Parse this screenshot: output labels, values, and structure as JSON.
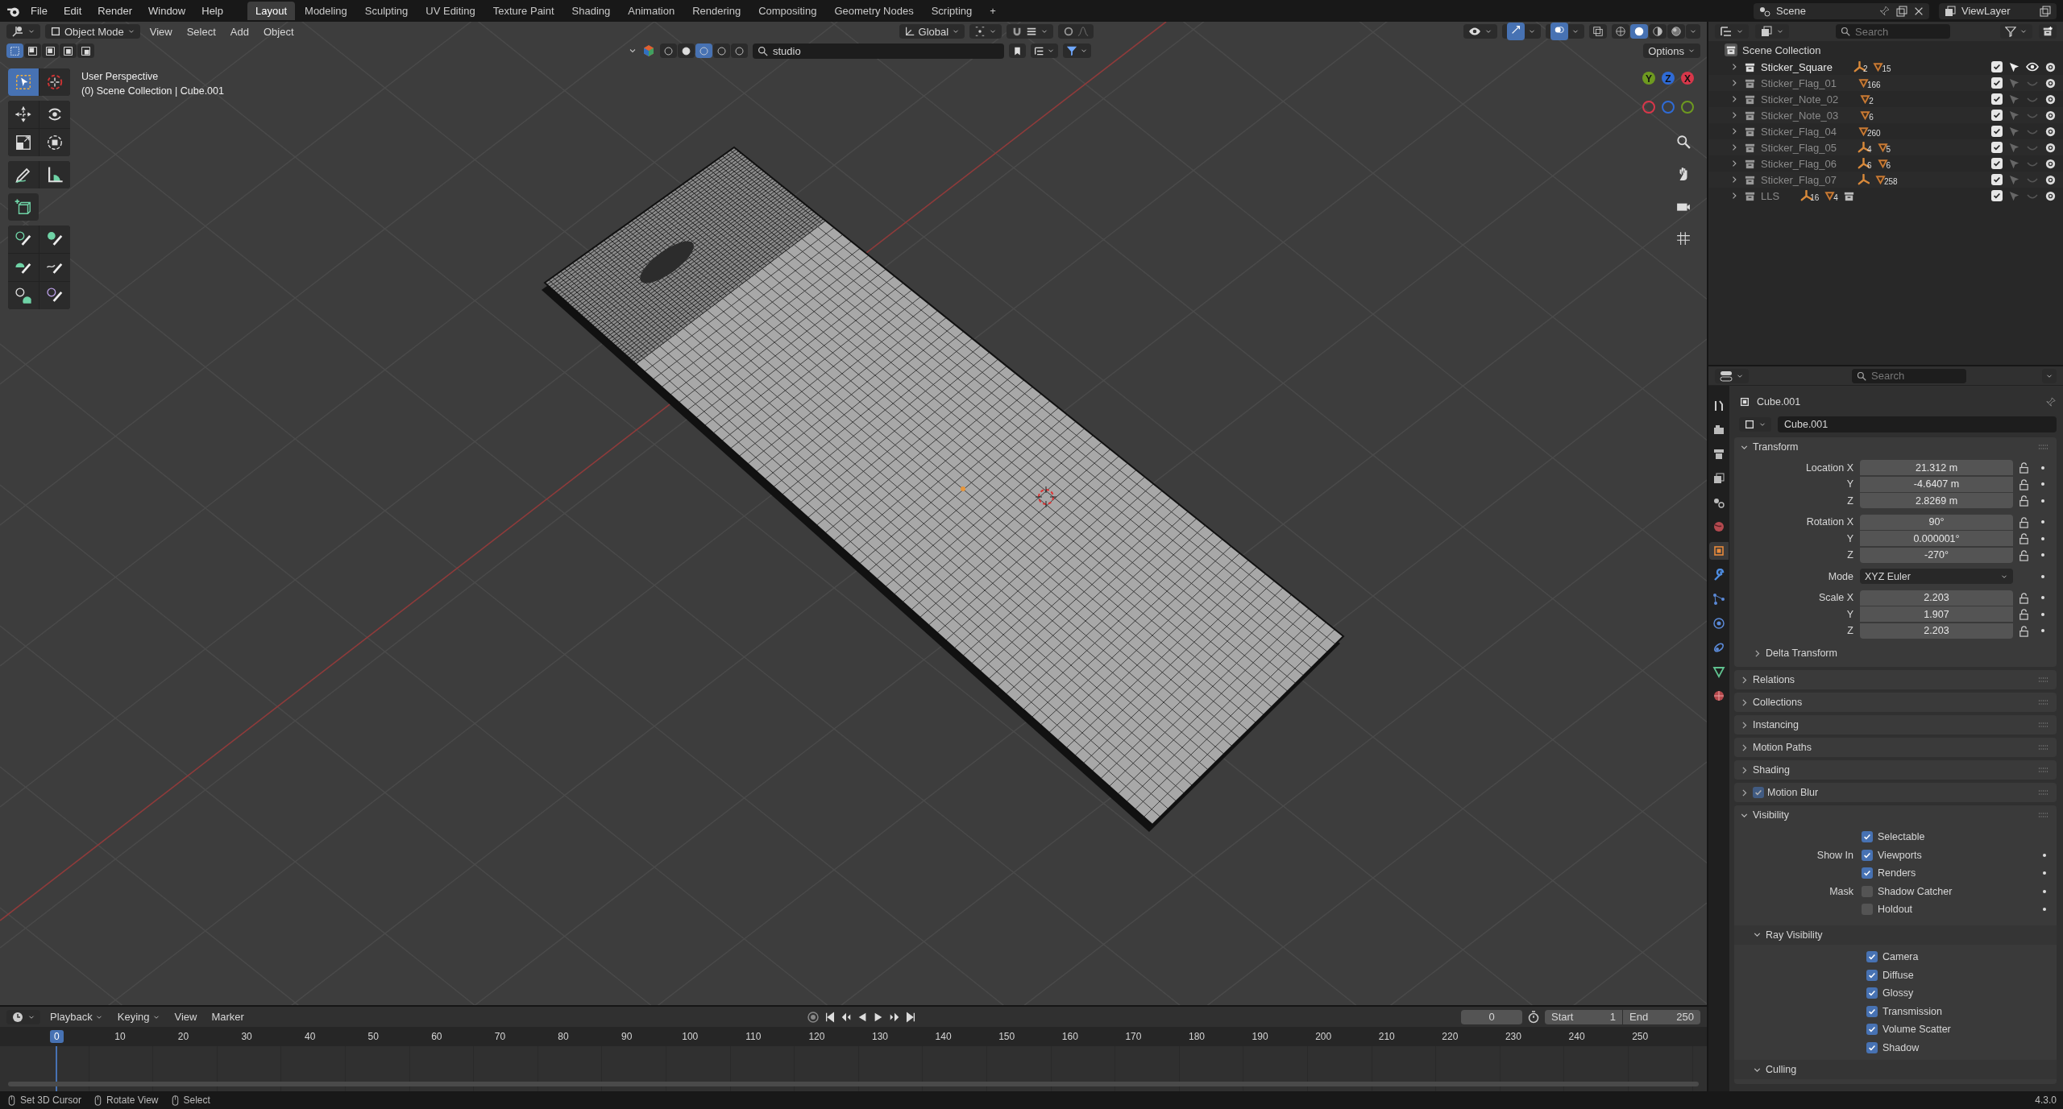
{
  "top_bar": {
    "menus": [
      "File",
      "Edit",
      "Render",
      "Window",
      "Help"
    ],
    "workspaces": [
      {
        "label": "Layout",
        "selected": true
      },
      {
        "label": "Modeling",
        "selected": false
      },
      {
        "label": "Sculpting",
        "selected": false
      },
      {
        "label": "UV Editing",
        "selected": false
      },
      {
        "label": "Texture Paint",
        "selected": false
      },
      {
        "label": "Shading",
        "selected": false
      },
      {
        "label": "Animation",
        "selected": false
      },
      {
        "label": "Rendering",
        "selected": false
      },
      {
        "label": "Compositing",
        "selected": false
      },
      {
        "label": "Geometry Nodes",
        "selected": false
      },
      {
        "label": "Scripting",
        "selected": false
      }
    ],
    "add_workspace": "+",
    "scene": "Scene",
    "view_layer": "ViewLayer"
  },
  "viewport": {
    "mode": "Object Mode",
    "menus": [
      "View",
      "Select",
      "Add",
      "Object"
    ],
    "orientation": "Global",
    "select_modes": [
      {
        "selected": true
      },
      {
        "selected": false
      },
      {
        "selected": false
      },
      {
        "selected": false
      },
      {
        "selected": false
      }
    ],
    "search_value": "studio",
    "options": "Options",
    "shading_modes": [
      {
        "kind": "wireframe",
        "selected": false
      },
      {
        "kind": "solid",
        "selected": true
      },
      {
        "kind": "material",
        "selected": false
      },
      {
        "kind": "rendered",
        "selected": false
      }
    ],
    "info": [
      "User Perspective",
      "(0) Scene Collection | Cube.001"
    ],
    "tools": [
      {
        "kind": "select",
        "selected": true
      },
      {
        "kind": "cursor",
        "selected": false
      },
      {
        "kind": "move",
        "selected": false
      },
      {
        "kind": "rotate",
        "selected": false
      },
      {
        "kind": "scale",
        "selected": false
      },
      {
        "kind": "transform",
        "selected": false
      },
      {
        "kind": "annotate",
        "selected": false
      },
      {
        "kind": "measure",
        "selected": false
      },
      {
        "kind": "add_cube",
        "selected": false
      },
      {
        "kind": "bulb_brush",
        "selected": false
      },
      {
        "kind": "globe_brush",
        "selected": false
      },
      {
        "kind": "blob_brush",
        "selected": false
      },
      {
        "kind": "curve_brush",
        "selected": false
      },
      {
        "kind": "bulb_blob",
        "selected": false
      },
      {
        "kind": "bulb_brush_violet",
        "selected": false
      }
    ],
    "axes": [
      {
        "label": "Y",
        "color": "#6e9a20"
      },
      {
        "label": "Z",
        "color": "#2f6bd6"
      },
      {
        "label": "X",
        "color": "#d8374a"
      }
    ]
  },
  "outliner": {
    "search_placeholder": "Search",
    "root": "Scene Collection",
    "items": [
      {
        "name": "Sticker_Square",
        "visible": true,
        "checked": true,
        "contents": [
          {
            "kind": "armature",
            "count": "2"
          },
          {
            "kind": "mesh",
            "count": "15"
          }
        ]
      },
      {
        "name": "Sticker_Flag_01",
        "visible": false,
        "checked": true,
        "contents": [
          {
            "kind": "mesh",
            "count": "166"
          }
        ]
      },
      {
        "name": "Sticker_Note_02",
        "visible": false,
        "checked": true,
        "contents": [
          {
            "kind": "mesh",
            "count": "2"
          }
        ]
      },
      {
        "name": "Sticker_Note_03",
        "visible": false,
        "checked": true,
        "contents": [
          {
            "kind": "mesh",
            "count": "6"
          }
        ]
      },
      {
        "name": "Sticker_Flag_04",
        "visible": false,
        "checked": true,
        "contents": [
          {
            "kind": "mesh",
            "count": "260"
          }
        ]
      },
      {
        "name": "Sticker_Flag_05",
        "visible": false,
        "checked": true,
        "contents": [
          {
            "kind": "armature",
            "count": "4"
          },
          {
            "kind": "mesh",
            "count": "5"
          }
        ]
      },
      {
        "name": "Sticker_Flag_06",
        "visible": false,
        "checked": true,
        "contents": [
          {
            "kind": "armature",
            "count": "6"
          },
          {
            "kind": "mesh",
            "count": "6"
          }
        ]
      },
      {
        "name": "Sticker_Flag_07",
        "visible": false,
        "checked": true,
        "contents": [
          {
            "kind": "armature"
          },
          {
            "kind": "mesh",
            "count": "258"
          }
        ]
      },
      {
        "name": "LLS",
        "visible": false,
        "checked": true,
        "contents": [
          {
            "kind": "armature",
            "count": "16"
          },
          {
            "kind": "mesh",
            "count": "4"
          },
          {
            "kind": "collection"
          }
        ]
      }
    ]
  },
  "properties": {
    "search_placeholder": "Search",
    "tabs": [
      {
        "kind": "tool",
        "selected": false
      },
      {
        "kind": "render",
        "selected": false
      },
      {
        "kind": "output",
        "selected": false
      },
      {
        "kind": "view_layer",
        "selected": false
      },
      {
        "kind": "scene",
        "selected": false
      },
      {
        "kind": "world",
        "selected": false
      },
      {
        "kind": "object",
        "selected": true
      },
      {
        "kind": "modifiers",
        "selected": false
      },
      {
        "kind": "particles",
        "selected": false
      },
      {
        "kind": "physics",
        "selected": false
      },
      {
        "kind": "constraints",
        "selected": false
      },
      {
        "kind": "data",
        "selected": false
      },
      {
        "kind": "material",
        "selected": false
      }
    ],
    "object_name": "Cube.001",
    "datablock": "Cube.001",
    "transform": {
      "title": "Transform",
      "expanded": true,
      "groups": [
        [
          {
            "label": "Location X",
            "value": "21.312 m",
            "kind": "number"
          },
          {
            "label": "Y",
            "value": "-4.6407 m",
            "kind": "number"
          },
          {
            "label": "Z",
            "value": "2.8269 m",
            "kind": "number"
          }
        ],
        [
          {
            "label": "Rotation X",
            "value": "90°",
            "kind": "number"
          },
          {
            "label": "Y",
            "value": "0.000001°",
            "kind": "number"
          },
          {
            "label": "Z",
            "value": "-270°",
            "kind": "number"
          }
        ],
        [
          {
            "label": "Mode",
            "value": "XYZ Euler",
            "kind": "dropdown"
          }
        ],
        [
          {
            "label": "Scale X",
            "value": "2.203",
            "kind": "number"
          },
          {
            "label": "Y",
            "value": "1.907",
            "kind": "number"
          },
          {
            "label": "Z",
            "value": "2.203",
            "kind": "number"
          }
        ]
      ],
      "subpanel": {
        "title": "Delta Transform",
        "expanded": false
      }
    },
    "panels": [
      {
        "title": "Relations",
        "expanded": false
      },
      {
        "title": "Collections",
        "expanded": false
      },
      {
        "title": "Instancing",
        "expanded": false
      },
      {
        "title": "Motion Paths",
        "expanded": false
      },
      {
        "title": "Shading",
        "expanded": false
      },
      {
        "title": "Motion Blur",
        "expanded": false,
        "checked": true
      }
    ],
    "visibility": {
      "title": "Visibility",
      "expanded": true,
      "rows": [
        {
          "option": "Selectable",
          "checked": true,
          "animatable": false
        },
        {
          "label": "Show In",
          "option": "Viewports",
          "checked": true,
          "animatable": true
        },
        {
          "option": "Renders",
          "checked": true,
          "animatable": true
        },
        {
          "label": "Mask",
          "option": "Shadow Catcher",
          "checked": false,
          "animatable": true
        },
        {
          "option": "Holdout",
          "checked": false,
          "animatable": true
        }
      ],
      "ray_visibility": {
        "title": "Ray Visibility",
        "expanded": true,
        "options": [
          {
            "label": "Camera",
            "checked": true
          },
          {
            "label": "Diffuse",
            "checked": true
          },
          {
            "label": "Glossy",
            "checked": true
          },
          {
            "label": "Transmission",
            "checked": true
          },
          {
            "label": "Volume Scatter",
            "checked": true
          },
          {
            "label": "Shadow",
            "checked": true
          }
        ]
      },
      "culling": {
        "title": "Culling",
        "expanded": true
      }
    }
  },
  "timeline": {
    "menus": [
      "Playback",
      "Keying",
      "View",
      "Marker"
    ],
    "current_frame": "0",
    "start_label": "Start",
    "start": "1",
    "end_label": "End",
    "end": "250",
    "playhead": "0",
    "ruler": [
      "10",
      "20",
      "30",
      "40",
      "50",
      "60",
      "70",
      "80",
      "90",
      "100",
      "110",
      "120",
      "130",
      "140",
      "150",
      "160",
      "170",
      "180",
      "190",
      "200",
      "210",
      "220",
      "230",
      "240",
      "250"
    ]
  },
  "status_bar": {
    "hints": [
      "Set 3D Cursor",
      "Rotate View",
      "Select"
    ],
    "version": "4.3.0"
  }
}
